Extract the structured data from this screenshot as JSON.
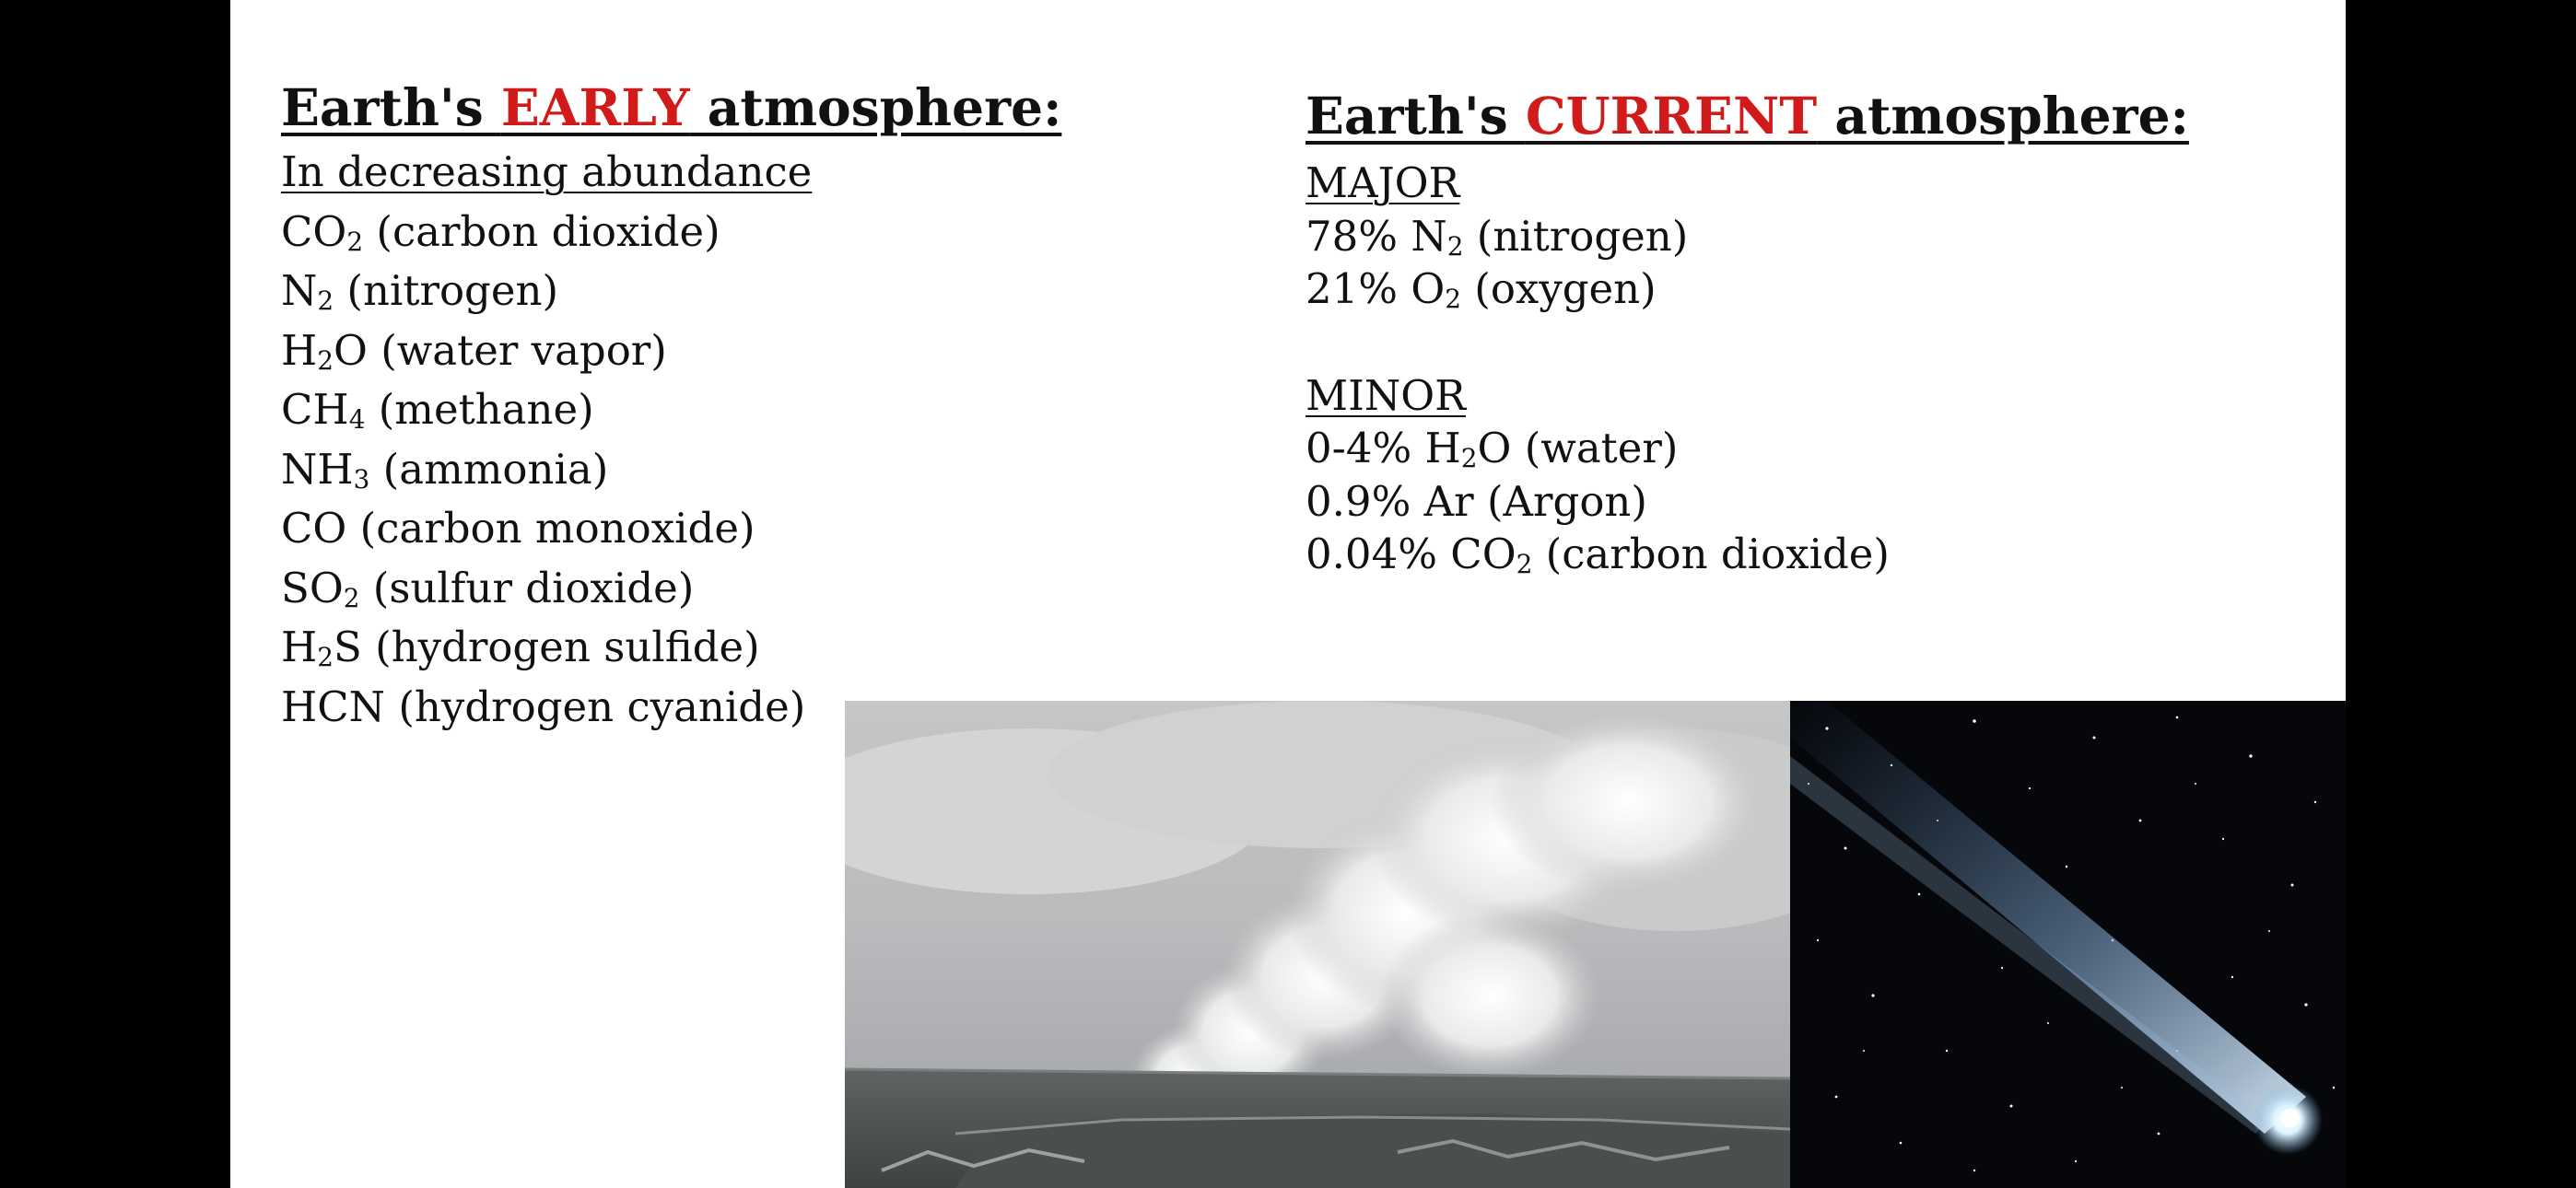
{
  "left": {
    "heading_prefix": "Earth's ",
    "heading_highlight": "EARLY",
    "heading_suffix": " atmosphere:",
    "subheading": "In decreasing abundance",
    "items": [
      {
        "formula_a": "CO",
        "formula_sub": "2",
        "formula_b": "",
        "desc": " (carbon dioxide)"
      },
      {
        "formula_a": "N",
        "formula_sub": "2",
        "formula_b": "",
        "desc": " (nitrogen)"
      },
      {
        "formula_a": "H",
        "formula_sub": "2",
        "formula_b": "O",
        "desc": " (water vapor)"
      },
      {
        "formula_a": "CH",
        "formula_sub": "4",
        "formula_b": "",
        "desc": " (methane)"
      },
      {
        "formula_a": "NH",
        "formula_sub": "3",
        "formula_b": "",
        "desc": " (ammonia)"
      },
      {
        "formula_a": "CO",
        "formula_sub": "",
        "formula_b": "",
        "desc": " (carbon monoxide)"
      },
      {
        "formula_a": "SO",
        "formula_sub": "2",
        "formula_b": "",
        "desc": " (sulfur dioxide)"
      },
      {
        "formula_a": "H",
        "formula_sub": "2",
        "formula_b": "S",
        "desc": " (hydrogen sulfide)"
      },
      {
        "formula_a": "HCN",
        "formula_sub": "",
        "formula_b": "",
        "desc": " (hydrogen cyanide)"
      }
    ]
  },
  "right": {
    "heading_prefix": "Earth's ",
    "heading_highlight": "CURRENT",
    "heading_suffix": " atmosphere:",
    "major_label": "MAJOR",
    "major_items": [
      {
        "pct": "78% ",
        "formula_a": "N",
        "formula_sub": "2",
        "formula_b": "",
        "desc": " (nitrogen)"
      },
      {
        "pct": "21% ",
        "formula_a": "O",
        "formula_sub": "2",
        "formula_b": "",
        "desc": " (oxygen)"
      }
    ],
    "minor_label": "MINOR",
    "minor_items": [
      {
        "pct": "0-4% ",
        "formula_a": "H",
        "formula_sub": "2",
        "formula_b": "O",
        "desc": " (water)"
      },
      {
        "pct": "0.9% ",
        "formula_a": "Ar",
        "formula_sub": "",
        "formula_b": "",
        "desc": " (Argon)"
      },
      {
        "pct": "0.04% ",
        "formula_a": "CO",
        "formula_sub": "2",
        "formula_b": "",
        "desc": " (carbon dioxide)"
      }
    ]
  },
  "colors": {
    "highlight": "#d11a1a",
    "text": "#111111",
    "letterbox": "#000000",
    "slide": "#ffffff"
  },
  "images": {
    "left_photo_icon": "volcano-plume-photo",
    "right_photo_icon": "comet-photo"
  }
}
